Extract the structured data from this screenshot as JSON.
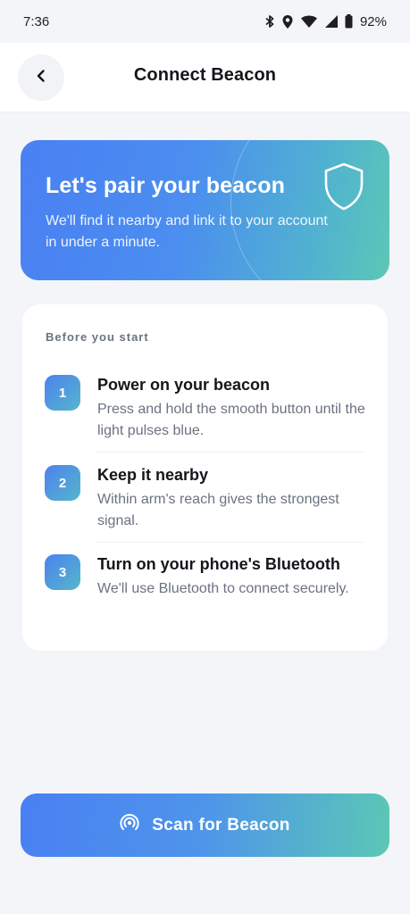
{
  "status_bar": {
    "time": "7:36",
    "battery": "92%",
    "icons": [
      "bluetooth-icon",
      "location-icon",
      "wifi-icon",
      "signal-icon",
      "battery-icon"
    ]
  },
  "header": {
    "title": "Connect Beacon",
    "back_icon": "chevron-left-icon"
  },
  "hero": {
    "title": "Let's pair your beacon",
    "subtitle": "We'll find it nearby and link it to your account in under a minute.",
    "icon": "shield-icon"
  },
  "steps": {
    "heading": "Before you start",
    "items": [
      {
        "number": "1",
        "title": "Power on your beacon",
        "description": "Press and hold the smooth button until the light pulses blue."
      },
      {
        "number": "2",
        "title": "Keep it nearby",
        "description": "Within arm's reach gives the strongest signal."
      },
      {
        "number": "3",
        "title": "Turn on your phone's Bluetooth",
        "description": "We'll use Bluetooth to connect securely."
      }
    ]
  },
  "scan_button": {
    "label": "Scan for Beacon",
    "icon": "broadcast-icon"
  },
  "colors": {
    "accent_start": "#4a80f3",
    "accent_end": "#5cc7b6",
    "background": "#f3f5f8"
  }
}
